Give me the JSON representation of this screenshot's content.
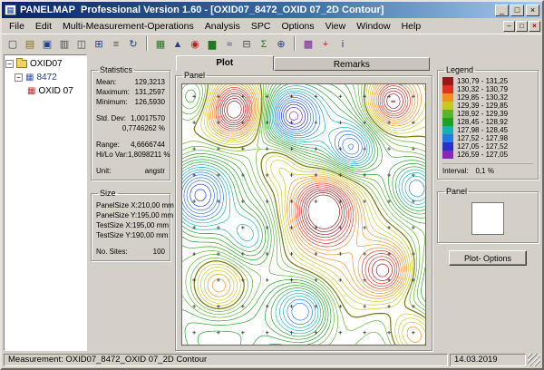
{
  "window": {
    "app_name": "PANELMAP",
    "title_rest": "Professional Version 1.60 - [OXID07_8472_OXID 07_2D Contour]",
    "minimize_glyph": "_",
    "maximize_glyph": "□",
    "close_glyph": "×"
  },
  "menu": {
    "items": [
      {
        "label": "File"
      },
      {
        "label": "Edit"
      },
      {
        "label": "Multi-Measurement-Operations"
      },
      {
        "label": "Analysis"
      },
      {
        "label": "SPC"
      },
      {
        "label": "Options"
      },
      {
        "label": "View"
      },
      {
        "label": "Window"
      },
      {
        "label": "Help"
      }
    ],
    "child_minimize_glyph": "–",
    "child_restore_glyph": "□",
    "child_close_glyph": "×"
  },
  "toolbar": {
    "icons": [
      {
        "name": "new-document",
        "glyph": "▢",
        "color": "#4a4a4a"
      },
      {
        "name": "open-panel",
        "glyph": "▤",
        "color": "#8a6d1a"
      },
      {
        "name": "save",
        "glyph": "▣",
        "color": "#23408f"
      },
      {
        "name": "print",
        "glyph": "▥",
        "color": "#4a4a4a"
      },
      {
        "name": "copy",
        "glyph": "◫",
        "color": "#4a4a4a"
      },
      {
        "name": "window-cascade",
        "glyph": "⊞",
        "color": "#23408f"
      },
      {
        "name": "tree-view",
        "glyph": "≡",
        "color": "#4a4a4a"
      },
      {
        "name": "refresh",
        "glyph": "↻",
        "color": "#23408f"
      },
      {
        "name": "plot-2d",
        "glyph": "▦",
        "color": "#1e7a1e"
      },
      {
        "name": "plot-3d",
        "glyph": "▲",
        "color": "#23408f"
      },
      {
        "name": "contour-plot",
        "glyph": "◉",
        "color": "#b22222"
      },
      {
        "name": "histogram",
        "glyph": "▆",
        "color": "#1e7a1e"
      },
      {
        "name": "line-chart",
        "glyph": "≈",
        "color": "#23408f"
      },
      {
        "name": "data-table",
        "glyph": "⊟",
        "color": "#4a4a4a"
      },
      {
        "name": "spc-chart",
        "glyph": "Σ",
        "color": "#1e7a1e"
      },
      {
        "name": "zoom-in",
        "glyph": "⊕",
        "color": "#23408f"
      },
      {
        "name": "color-legend",
        "glyph": "▩",
        "color": "#7a1ea0"
      },
      {
        "name": "sites",
        "glyph": "+",
        "color": "#b22222"
      },
      {
        "name": "info",
        "glyph": "i",
        "color": "#23408f"
      }
    ]
  },
  "tree": {
    "items": [
      {
        "label": "OXID07"
      },
      {
        "label": "8472"
      },
      {
        "label": "OXID 07"
      }
    ]
  },
  "tabs": {
    "plot": "Plot",
    "remarks": "Remarks"
  },
  "statistics": {
    "title": "Statistics",
    "rows": [
      [
        "Mean:",
        "129,3213"
      ],
      [
        "Maximum:",
        "131,2597"
      ],
      [
        "Minimum:",
        "126,5930"
      ],
      [
        "Std. Dev:",
        "1,0017570"
      ],
      [
        "",
        "0,7746262 %"
      ],
      [
        "Range:",
        "4,6666744"
      ],
      [
        "Hi/Lo Var:",
        "1,8098211 %"
      ],
      [
        "Unit:",
        "angstr"
      ]
    ]
  },
  "size": {
    "title": "Size",
    "rows": [
      [
        "PanelSize X:",
        "210,00 mm"
      ],
      [
        "PanelSize Y:",
        "195,00 mm"
      ],
      [
        "TestSize X:",
        "195,00 mm"
      ],
      [
        "TestSize Y:",
        "190,00 mm"
      ],
      [
        "No. Sites:",
        "100"
      ]
    ]
  },
  "panel": {
    "title": "Panel"
  },
  "legend": {
    "title": "Legend",
    "interval_label": "Interval:",
    "interval_value": "0,1 %"
  },
  "panel_preview": {
    "title": "Panel"
  },
  "buttons": {
    "plot_options": "Plot- Options"
  },
  "statusbar": {
    "measurement": "Measurement: OXID07_8472_OXID 07_2D Contour",
    "date": "14.03.2019"
  },
  "chart_data": {
    "type": "contour",
    "title": "Panel",
    "unit": "angstr",
    "value_range": [
      126.59,
      131.25
    ],
    "mean": 129.3213,
    "maximum": 131.2597,
    "minimum": 126.593,
    "contour_interval": "0,1 %",
    "num_sites": 100,
    "site_grid": [
      10,
      10
    ],
    "bands": [
      {
        "range": "130,79 - 131,25",
        "color": "#981818"
      },
      {
        "range": "130,32 - 130,79",
        "color": "#e03020"
      },
      {
        "range": "129,85 - 130,32",
        "color": "#f09020"
      },
      {
        "range": "129,39 - 129,85",
        "color": "#c8c820"
      },
      {
        "range": "128,92 - 129,39",
        "color": "#58b428"
      },
      {
        "range": "128,45 - 128,92",
        "color": "#20a020"
      },
      {
        "range": "127,98 - 128,45",
        "color": "#18b0b0"
      },
      {
        "range": "127,52 - 127,98",
        "color": "#2878e0"
      },
      {
        "range": "127,05 - 127,52",
        "color": "#2830c8"
      },
      {
        "range": "126,59 - 127,05",
        "color": "#8828b8"
      }
    ]
  }
}
